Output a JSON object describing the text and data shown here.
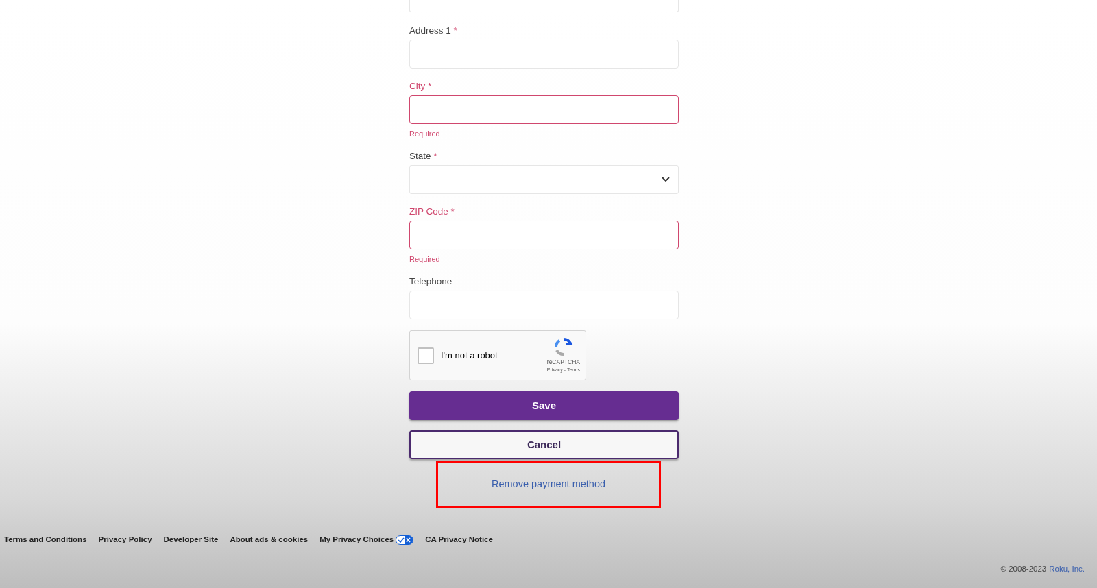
{
  "form": {
    "fields": [
      {
        "kind": "text",
        "label": "Address 1",
        "required_mark": "*",
        "error": false
      },
      {
        "kind": "text",
        "label": "City",
        "required_mark": "*",
        "error": true,
        "error_text": "Required"
      },
      {
        "kind": "select",
        "label": "State",
        "required_mark": "*",
        "error": false
      },
      {
        "kind": "text",
        "label": "ZIP Code",
        "required_mark": "*",
        "error": true,
        "error_text": "Required"
      },
      {
        "kind": "text",
        "label": "Telephone",
        "error": false
      }
    ],
    "captcha": {
      "label": "I'm not a robot",
      "checked": false,
      "brand": "reCAPTCHA",
      "links": "Privacy - Terms"
    },
    "save": "Save",
    "cancel": "Cancel",
    "remove_link": "Remove payment method"
  },
  "footer": {
    "links": [
      {
        "label": "Terms and Conditions"
      },
      {
        "label": "Privacy Policy"
      },
      {
        "label": "Developer Site"
      },
      {
        "label": "About ads & cookies"
      },
      {
        "label": "My Privacy Choices",
        "toggle_icon": true
      },
      {
        "label": "CA Privacy Notice"
      }
    ],
    "copyright": "© 2008-2023",
    "company": "Roku, Inc."
  }
}
